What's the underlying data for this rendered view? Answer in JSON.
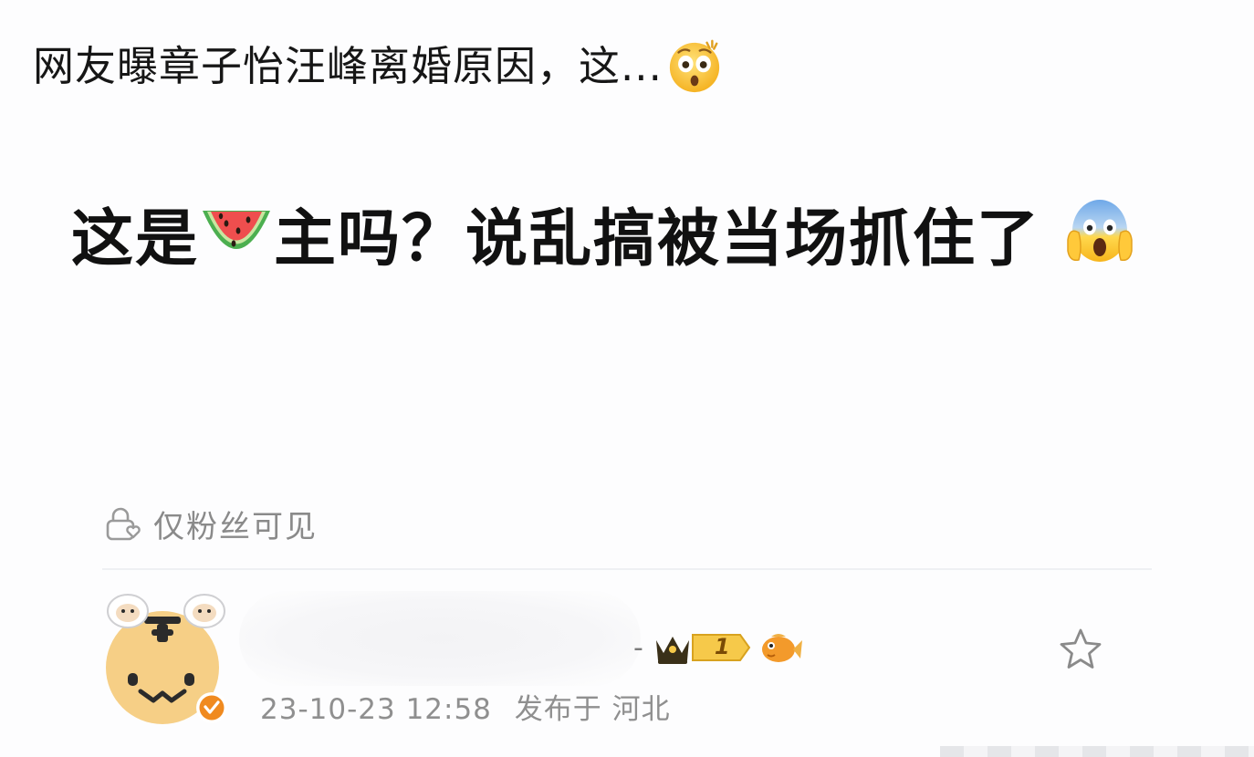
{
  "headline": {
    "text": "网友曝章子怡汪峰离婚原因，这...",
    "emoji": "astonished-face-icon"
  },
  "post": {
    "part1": "这是",
    "emoji_watermelon": "watermelon-icon",
    "part2": "主吗？说乱搞被当场抓住了",
    "emoji_scream": "face-screaming-in-fear-icon"
  },
  "visibility": {
    "icon": "lock-heart-icon",
    "label": "仅粉丝可见"
  },
  "author": {
    "avatar": "tiger-cartoon-avatar",
    "verified_badge": "orange-verified-icon",
    "name_blurred": true,
    "badges": [
      "crown-icon",
      "level-badge",
      "fish-icon"
    ],
    "level": "1",
    "dash": "-"
  },
  "meta": {
    "timestamp": "23-10-23 12:58",
    "location": "发布于 河北"
  },
  "actions": {
    "favorite_icon": "star-outline-icon"
  },
  "colors": {
    "text_primary": "#111111",
    "text_secondary": "#8f8f8f",
    "verified": "#f08a1f",
    "crown": "#3a3019",
    "level_bg": "#f6c94a"
  }
}
